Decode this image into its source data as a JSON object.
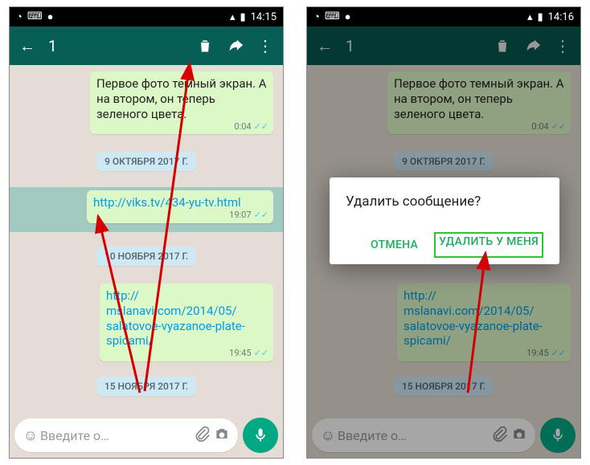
{
  "left": {
    "status": {
      "time": "14:15"
    },
    "toolbar": {
      "selected_count": "1"
    },
    "messages": {
      "m1": {
        "text": "Первое фото темный экран. А на втором, он теперь зеленого цвета.",
        "time": "0:04"
      },
      "m2": {
        "text": "http://viks.tv/434-yu-tv.html",
        "time": "19:07"
      },
      "m3_l1": "http://",
      "m3_l2": "mslanavi.com/2014/05/",
      "m3_l3": "salatovoe-vyazanoe-plate-",
      "m3_l4": "spicami/",
      "m3_time": "19:45"
    },
    "dates": {
      "d1": "9 ОКТЯБРЯ 2017 Г.",
      "d2": "10 НОЯБРЯ 2017 Г.",
      "d3": "15 НОЯБРЯ 2017 Г."
    },
    "input": {
      "placeholder": "Введите о…"
    }
  },
  "right": {
    "status": {
      "time": "14:16"
    },
    "toolbar": {
      "selected_count": "1"
    },
    "dialog": {
      "title": "Удалить сообщение?",
      "cancel": "ОТМЕНА",
      "confirm": "УДАЛИТЬ У МЕНЯ"
    },
    "messages": {
      "m1": {
        "text": "Первое фото темный экран. А на втором, он теперь зеленого цвета.",
        "time": "0:04"
      },
      "m3_l1": "http://",
      "m3_l2": "mslanavi.com/2014/05/",
      "m3_l3": "salatovoe-vyazanoe-plate-",
      "m3_l4": "spicami/",
      "m3_time": "19:45"
    },
    "dates": {
      "d1": "9 ОКТЯБРЯ 2017 Г.",
      "d3": "15 НОЯБРЯ 2017 Г."
    }
  }
}
